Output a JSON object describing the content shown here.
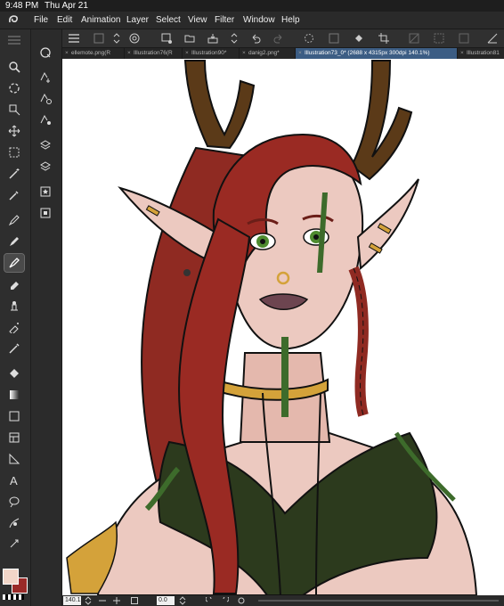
{
  "status_bar": {
    "time": "9:48 PM",
    "date": "Thu Apr 21"
  },
  "menu": [
    "File",
    "Edit",
    "Animation",
    "Layer",
    "Select",
    "View",
    "Filter",
    "Window",
    "Help"
  ],
  "tabs": [
    {
      "label": "ellemote.png(R"
    },
    {
      "label": "Illustration76(R"
    },
    {
      "label": "Illustration90*"
    },
    {
      "label": "danig2.png*"
    },
    {
      "label": "Illustration73_0* (2688 x 4315px 300dpi 140.1%)",
      "active": true
    },
    {
      "label": "Illustration81"
    }
  ],
  "bottom_bar": {
    "zoom": "140.1",
    "rotation": "0.0"
  },
  "colors": {
    "foreground": "#f2d6c8",
    "background": "#9a2a28",
    "accent": "#3c5d84"
  }
}
